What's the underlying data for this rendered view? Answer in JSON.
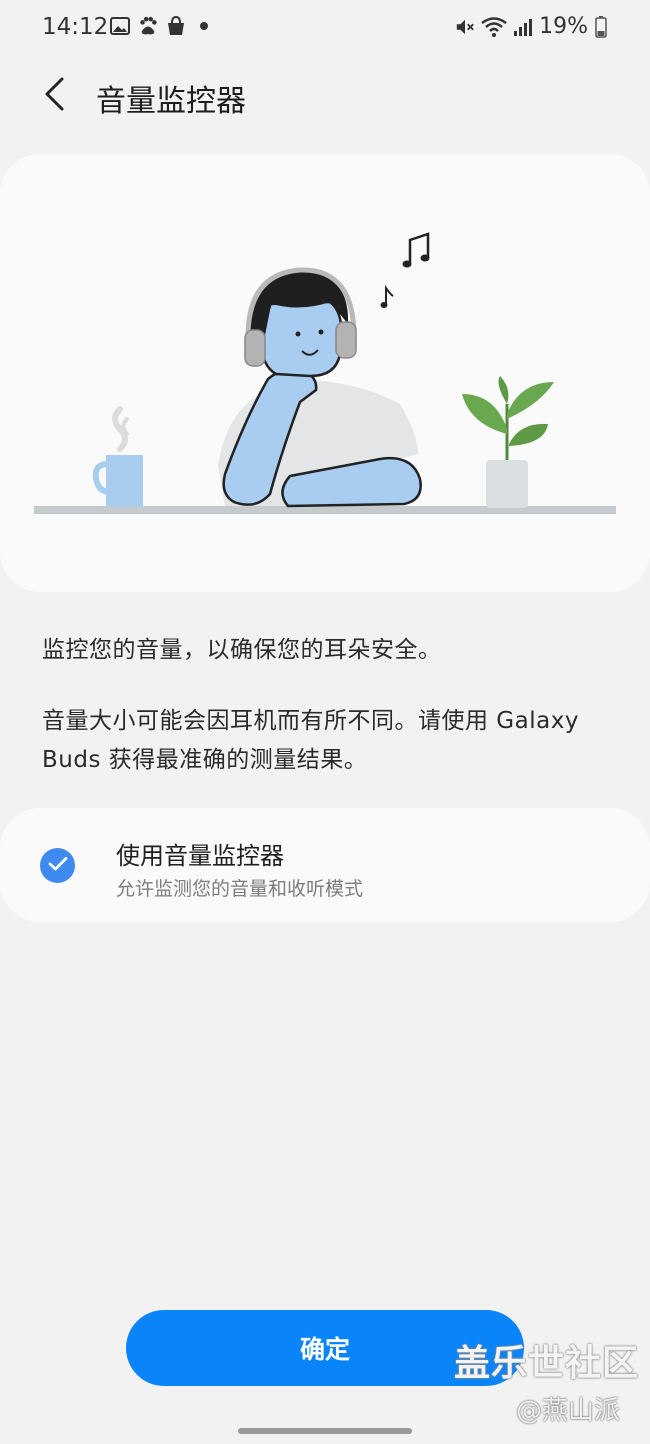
{
  "status_bar": {
    "time": "14:12",
    "battery": "19%",
    "icons": [
      "gallery-icon",
      "baidu-icon",
      "shopping-bag-icon",
      "dot-icon",
      "mute-icon",
      "wifi-icon",
      "signal-icon",
      "battery-icon"
    ]
  },
  "header": {
    "title": "音量监控器",
    "back_icon": "chevron-left-icon"
  },
  "description": {
    "line1": "监控您的音量，以确保您的耳朵安全。",
    "line2": "音量大小可能会因耳机而有所不同。请使用 Galaxy Buds 获得最准确的测量结果。"
  },
  "option": {
    "title": "使用音量监控器",
    "subtitle": "允许监测您的音量和收听模式",
    "checked": true,
    "accent": "#3e8af0"
  },
  "confirm_button": {
    "label": "确定",
    "color": "#0a84f9"
  },
  "watermark": {
    "line1": "盖乐世社区",
    "line2": "@燕山派"
  }
}
